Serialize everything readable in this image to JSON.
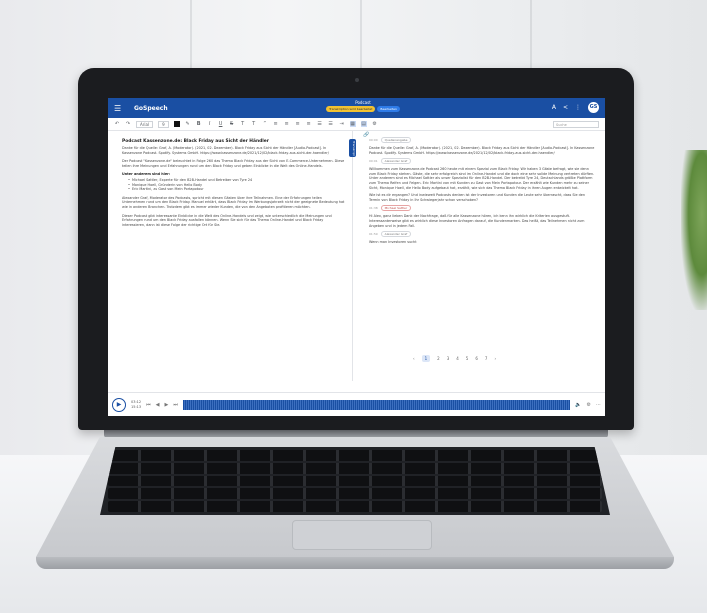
{
  "app": {
    "name": "GoSpeech",
    "avatar_initials": "GS"
  },
  "document": {
    "title": "Podcast",
    "status_chip": "Transkription wird bearbeitet",
    "mode_chip": "Bearbeiten"
  },
  "toolbar": {
    "font": "Arial",
    "size": "9",
    "search_placeholder": "Suche"
  },
  "left_pane": {
    "heading": "Podcast Kassenzone.de: Black Friday aus Sicht der Händler",
    "source": "Danke für die Quelle: Graf, A. (Moderator). (2021, 02. Dezember). Black Friday aus Sicht der Händler [Audio-Podcast]. In Kassenzone Podcast. Spotify. Systems GmbH. https://www.kassenzone.de/2021/12/02/black-friday-aus-sicht-der-haendler/",
    "intro": "Der Podcast \"Kassenzone.de\" beleuchtet in Folge 260 das Thema Black Friday aus der Sicht von E-Commerce-Unternehmen. Diese teilen ihre Meinungen und Erfahrungen rund um den Black Friday und geben Einblicke in die Welt des Online-Handels.",
    "guests_heading": "Unter anderem sind hier:",
    "guests": [
      "Michael Sattler, Experte für den B2B-Handel und Betreiber von Tyre 24",
      "Monique Hoell, Gründerin von Hello Body",
      "Eric Martini, zu Gast von Mein Portapotour"
    ],
    "p2": "Alexander Graf, Moderator des Podcasts, spricht mit diesen Gästen über ihre Teilnahmen. Eine der Erfahrungen teilen Unternehmen rund um den Black Friday. Manuel erklärt, dass Black Friday im Werbungsjahrzeit nicht der geeignete Bedeutung hat wie in anderen Branchen. Trotzdem gibt es immer wieder Kunden, die von den Angeboten profitieren möchten.",
    "p3": "Dieser Podcast gibt interessante Einblicke in die Welt des Online-Handels und zeigt, wie unterschiedlich die Meinungen und Erfahrungen rund um den Black Friday ausfallen können. Wenn Sie sich für das Thema Online-Handel und Black Friday interessieren, dann ist diese Folge der richtige Ort für Sie."
  },
  "right_pane": {
    "side_tab": "Transkript",
    "blocks": [
      {
        "time": "00:00",
        "speaker": "Quellenangabe",
        "red": false,
        "text": "Danke für die Quelle: Graf, A. (Moderator). (2021, 02. Dezember). Black Friday aus Sicht der Händler [Audio-Podcast]. In Kassenzone Podcast. Spotify. Systems GmbH. https://www.kassenzone.de/2021/12/02/black-friday-aus-sicht-der-haendler/"
      },
      {
        "time": "00:01",
        "speaker": "Alexander Graf",
        "red": false,
        "text": "Willkommen zum Kassenzone.de Podcast 260 heute mit einem Spezial zum Black Friday. Wir haben 3 Gäste befragt, wie sie denn zum Black Friday stehen. Gäste, die sehr erfolgreich sind im Online-Handel und die doch eine sehr solide Meinung vertreten dürften. Unter anderem sind es Michael Sattler als unser Spezialist für den B2B-Handel. Der betreibt Tyre 24, Deutschlands größte Plattform zum Thema Reifen und Felgen. Eric Martini von mit Kunden zu Gast von Mein Portapotour. Der erzählt wie Kunden mehr zu seiner Sicht, Monique Hoell, die Hello Body aufgebaut hat, erzählt, wie sich das Thema Black Friday in ihren Augen entwickelt hat."
      },
      {
        "time": "",
        "speaker": "",
        "red": false,
        "text": "Wie ist es dir ergangen? Und inwieweit Podcasts denken ist der Investoren und Kunden die Leute sehr überrascht, dass Sie den Termin von Black Friday in Ihr Schwiegerjahr schon verschoben?"
      },
      {
        "time": "01:38",
        "speaker": "Michael Sattler",
        "red": true,
        "text": "Hi Alex, ganz lieben Dank der Nachfrage, daß für alle Kassenzone hören, ich kenn ihn wirklich die Kriterien ausgestuft. Interessanterweise gibt es wirklich diese Investoren Anfragen darauf, die Kundenmarken. Das heißt, das Teilnehmen nicht zum Angeben und in jedem Fall."
      },
      {
        "time": "01:59",
        "speaker": "Alexander Graf",
        "red": false,
        "text": "Wenn man Investoren sucht"
      }
    ],
    "pages": [
      "1",
      "2",
      "3",
      "4",
      "5",
      "6",
      "7"
    ]
  },
  "player": {
    "current_time": "03:12",
    "total_time": "15:13"
  },
  "colors": {
    "brand": "#1a4fa3",
    "chip_yellow": "#f1c232",
    "chip_blue": "#2e7be8"
  }
}
